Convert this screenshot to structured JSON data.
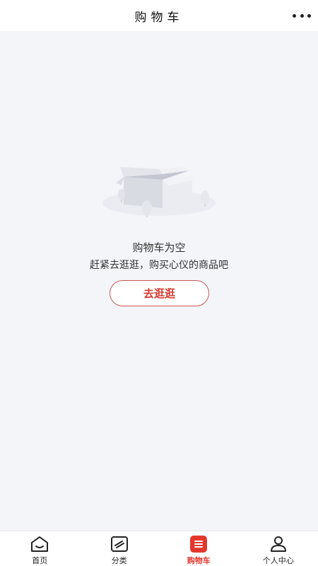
{
  "header": {
    "title": "购物车"
  },
  "empty": {
    "title": "购物车为空",
    "subtitle": "赶紧去逛逛，购买心仪的商品吧",
    "button_label": "去逛逛"
  },
  "tabbar": {
    "tabs": [
      {
        "label": "首页",
        "icon": "home-icon"
      },
      {
        "label": "分类",
        "icon": "category-icon"
      },
      {
        "label": "购物车",
        "icon": "cart-icon",
        "active": true
      },
      {
        "label": "个人中心",
        "icon": "profile-icon"
      }
    ]
  },
  "colors": {
    "accent": "#e2372d",
    "background": "#f4f5f9",
    "button_border": "#c9574f"
  }
}
